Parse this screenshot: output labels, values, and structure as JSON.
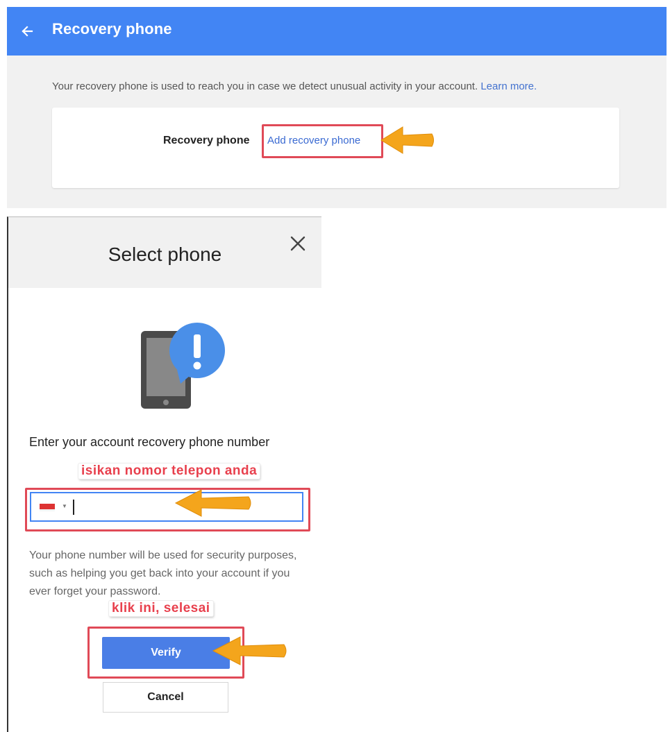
{
  "app_bar": {
    "title": "Recovery phone"
  },
  "info": {
    "text": "Your recovery phone is used to reach you in case we detect unusual activity in your account. ",
    "link": "Learn more."
  },
  "card": {
    "label": "Recovery phone",
    "link": "Add recovery phone"
  },
  "dialog": {
    "title": "Select phone",
    "prompt": "Enter your account recovery phone number",
    "help_text": "Your phone number will be used for security purposes, such as helping you get back into your account if you ever forget your password.",
    "verify_label": "Verify",
    "cancel_label": "Cancel"
  },
  "annotations": {
    "phone_hint": "isikan nomor telepon anda",
    "verify_hint": "klik ini, selesai"
  },
  "colors": {
    "app_bar": "#4285f4",
    "link": "#3a6ad2",
    "highlight": "#e04a57",
    "arrow": "#f4a51c",
    "verify_button": "#4a7ee6",
    "annotation_text": "#e8404d"
  },
  "icons": {
    "back": "arrow-left-icon",
    "close": "close-icon",
    "illustration": "phone-alert-icon",
    "flag": "indonesia-flag-icon"
  }
}
